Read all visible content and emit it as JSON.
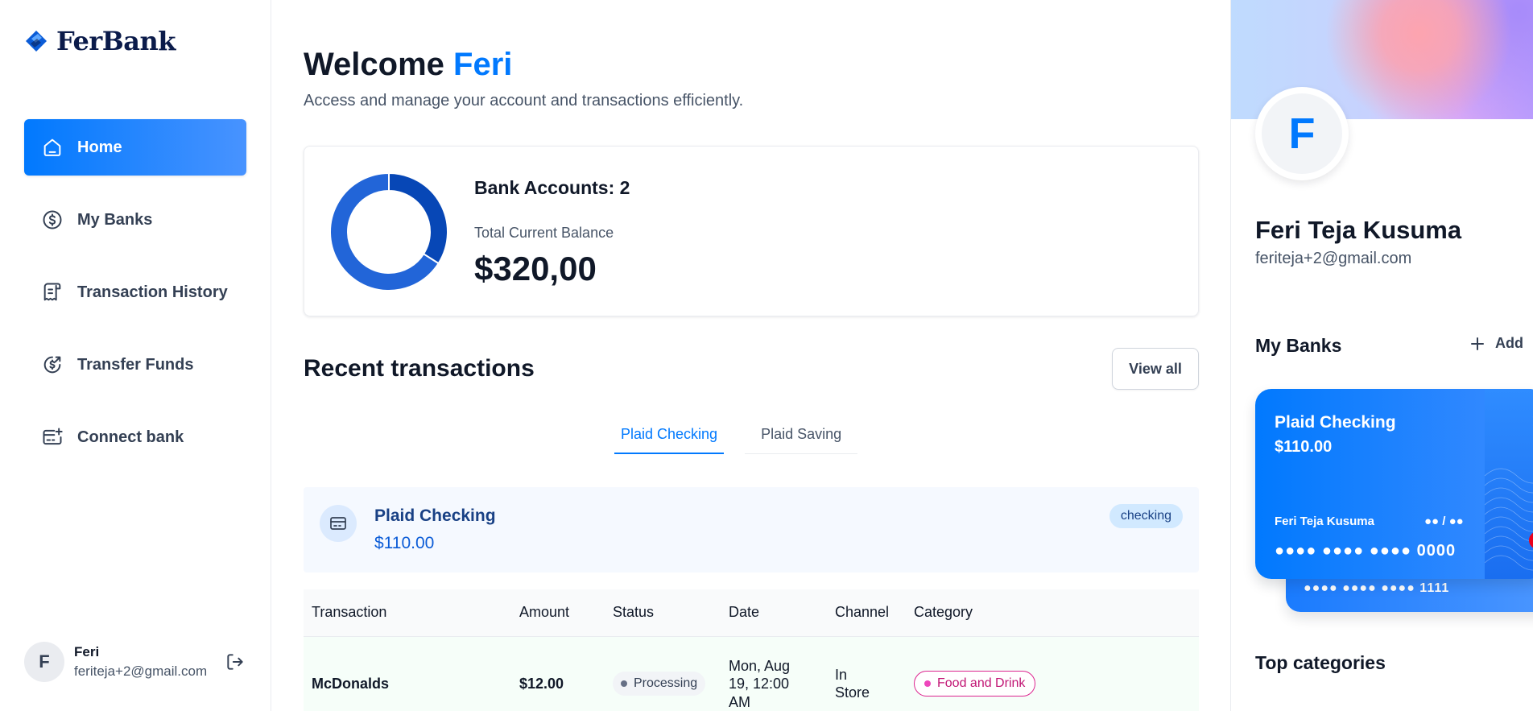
{
  "brand": {
    "name": "FerBank",
    "accent": "#0179fe"
  },
  "sidebar": {
    "items": [
      {
        "label": "Home",
        "icon": "home-icon",
        "active": true
      },
      {
        "label": "My Banks",
        "icon": "dollar-circle-icon",
        "active": false
      },
      {
        "label": "Transaction History",
        "icon": "receipt-icon",
        "active": false
      },
      {
        "label": "Transfer Funds",
        "icon": "money-send-icon",
        "active": false
      },
      {
        "label": "Connect bank",
        "icon": "card-add-icon",
        "active": false
      }
    ],
    "user": {
      "initial": "F",
      "name": "Feri",
      "email": "feriteja+2@gmail.com"
    }
  },
  "header": {
    "greeting": "Welcome",
    "name": "Feri",
    "subtitle": "Access and manage your account and transactions efficiently."
  },
  "balance": {
    "bank_accounts_label": "Bank Accounts: 2",
    "total_label": "Total Current Balance",
    "total_value": "$320,00",
    "donut_shares": [
      0.34,
      0.66
    ],
    "donut_colors": [
      "#0747b6",
      "#2265d8"
    ]
  },
  "transactions": {
    "title": "Recent transactions",
    "view_all": "View all",
    "tabs": [
      "Plaid Checking",
      "Plaid Saving"
    ],
    "account": {
      "name": "Plaid Checking",
      "balance": "$110.00",
      "type": "checking"
    },
    "columns": [
      "Transaction",
      "Amount",
      "Status",
      "Date",
      "Channel",
      "Category"
    ],
    "rows": [
      {
        "name": "McDonalds",
        "amount": "$12.00",
        "status": "Processing",
        "date": "Mon, Aug 19, 12:00 AM",
        "channel": "In Store",
        "category": "Food and Drink"
      }
    ]
  },
  "profile": {
    "initial": "F",
    "name": "Feri Teja Kusuma",
    "email": "feriteja+2@gmail.com"
  },
  "my_banks": {
    "title": "My Banks",
    "add_label": "Add",
    "cards": [
      {
        "name": "Plaid Checking",
        "balance": "$110.00",
        "holder": "Feri Teja Kusuma",
        "expiry": "●● / ●●",
        "number": "●●●● ●●●● ●●●● 0000"
      },
      {
        "number": "●●●● ●●●● ●●●● 1111"
      }
    ]
  },
  "top_categories": {
    "title": "Top categories"
  }
}
